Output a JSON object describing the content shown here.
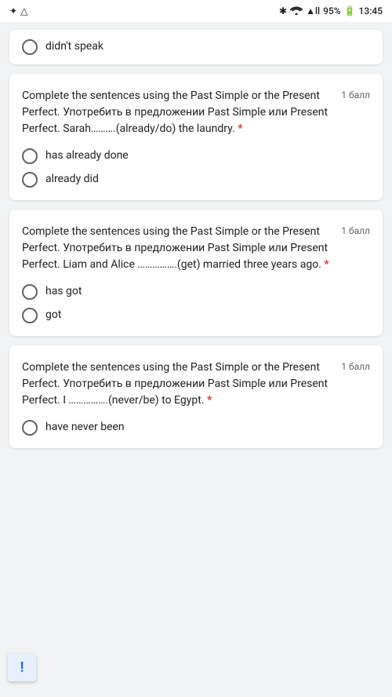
{
  "statusBar": {
    "bluetooth": "✦",
    "wifi": "WiFi",
    "signal": "▲▲▲",
    "battery": "95%",
    "time": "13:45"
  },
  "partialCard": {
    "option": "didn't speak"
  },
  "questions": [
    {
      "id": "q1",
      "text": "Complete the sentences using the Past Simple or the Present Perfect. Употребить в предложении Past Simple или Present Perfect. Sarah……….(already/do) the laundry.",
      "required": true,
      "points": "1 балл",
      "options": [
        {
          "id": "q1o1",
          "label": "has already done"
        },
        {
          "id": "q1o2",
          "label": "already did"
        }
      ]
    },
    {
      "id": "q2",
      "text": "Complete the sentences using the Past Simple or the Present Perfect. Употребить в предложении Past Simple или Present Perfect. Liam and Alice …………….(get) married three years ago.",
      "required": true,
      "points": "1 балл",
      "options": [
        {
          "id": "q2o1",
          "label": "has got"
        },
        {
          "id": "q2o2",
          "label": "got"
        }
      ]
    },
    {
      "id": "q3",
      "text": "Complete the sentences using the Past Simple or the Present Perfect. Употребить в предложении Past Simple или Present Perfect. I …………….(never/be) to Egypt.",
      "required": true,
      "points": "1 балл",
      "options": [
        {
          "id": "q3o1",
          "label": "have never been"
        }
      ]
    }
  ],
  "alertButton": {
    "label": "!"
  }
}
